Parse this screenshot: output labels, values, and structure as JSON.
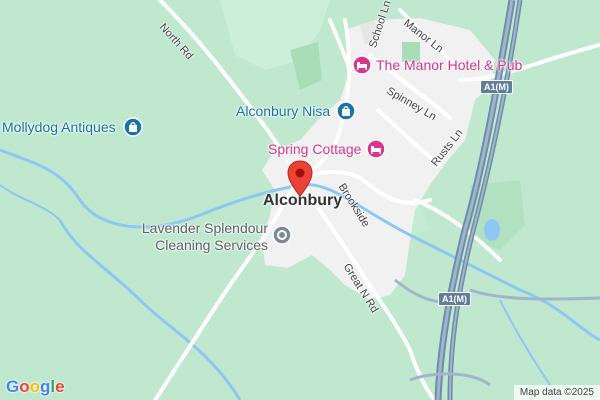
{
  "map": {
    "place_label": "Alconbury",
    "roads": {
      "north_rd": "North Rd",
      "school_ln": "School Ln",
      "manor_ln": "Manor Ln",
      "spinney_ln": "Spinney Ln",
      "rusts_ln": "Rusts Ln",
      "brookside": "Brookside",
      "great_n_rd": "Great N Rd"
    },
    "road_shields": [
      "A1(M)",
      "A1(M)"
    ],
    "pois": {
      "manor_hotel": {
        "label": "The Manor Hotel & Pub",
        "icon": "bed-icon",
        "color": "#d6368c"
      },
      "alconbury_nisa": {
        "label": "Alconbury Nisa",
        "icon": "shopping-bag-icon",
        "color": "#1a73a8"
      },
      "spring_cottage": {
        "label": "Spring Cottage",
        "icon": "bed-icon",
        "color": "#d6368c"
      },
      "mollydog": {
        "label": "Mollydog Antiques",
        "icon": "shopping-bag-icon",
        "color": "#1a73a8"
      },
      "lavender": {
        "line1": "Lavender Splendour",
        "line2": "Cleaning Services",
        "icon": "generic-poi-icon",
        "color": "#7d8a94"
      }
    },
    "marker": {
      "icon": "location-pin-icon",
      "color": "#ea4335"
    },
    "branding": {
      "logo": "Google",
      "logo_colors": [
        "#4285f4",
        "#ea4335",
        "#fbbc05",
        "#4285f4",
        "#34a853",
        "#ea4335"
      ]
    },
    "attribution": "Map data ©2025"
  }
}
